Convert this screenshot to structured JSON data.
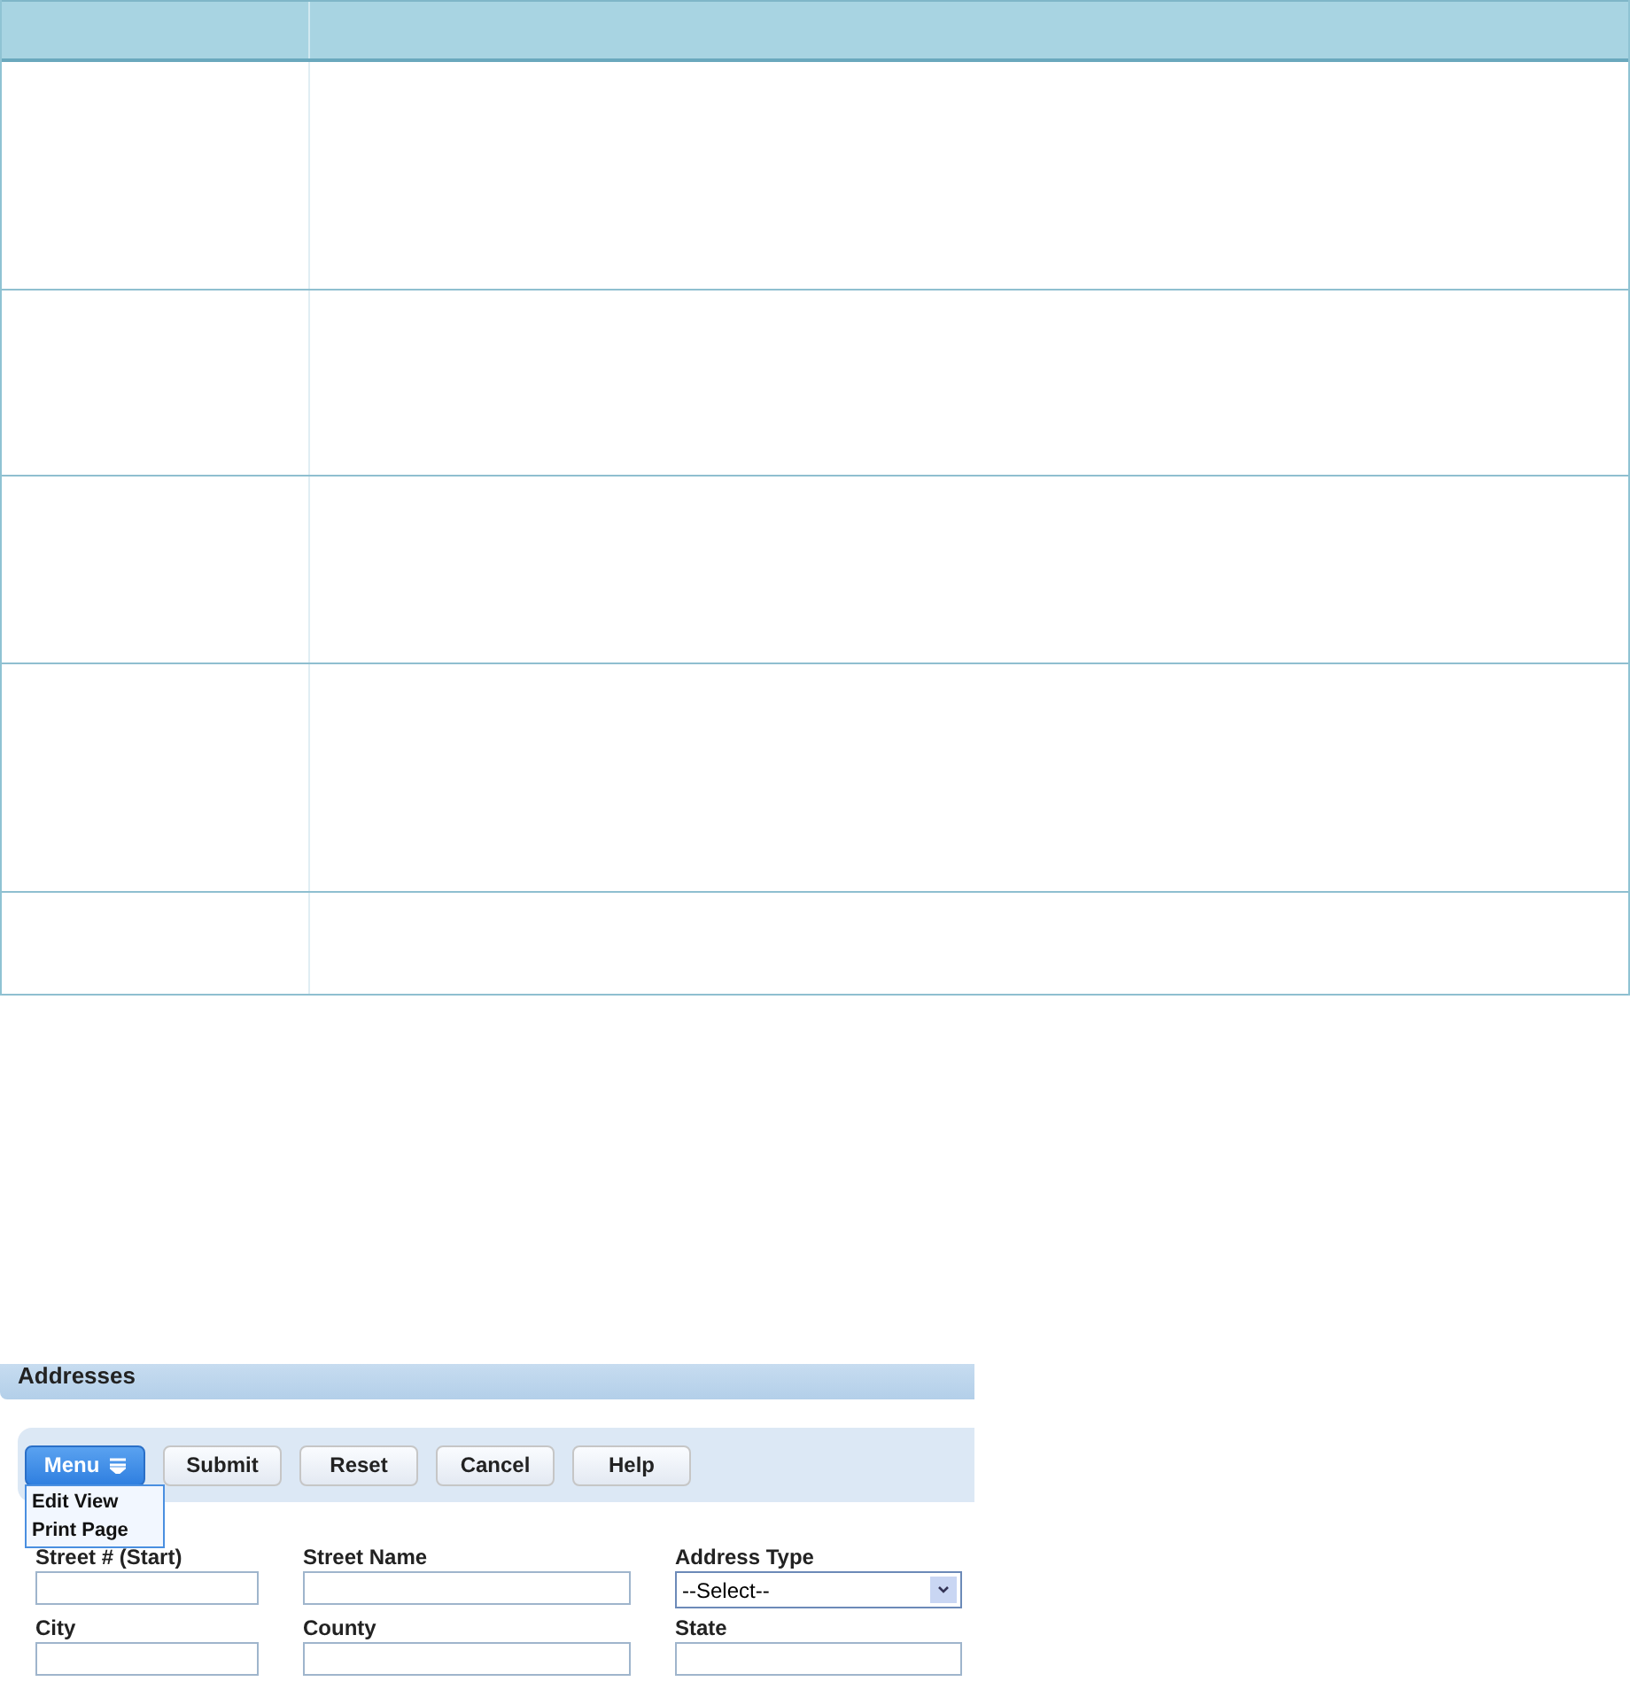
{
  "form": {
    "title": "Addresses",
    "menu": {
      "label": "Menu",
      "expanded": true,
      "items": [
        "Edit View",
        "Print Page"
      ]
    },
    "buttons": [
      "Submit",
      "Reset",
      "Cancel",
      "Help"
    ],
    "fields": [
      {
        "label": "Street # (Start)",
        "kind": "text"
      },
      {
        "label": "Street Name",
        "kind": "text"
      },
      {
        "label": "Address Type",
        "kind": "select",
        "value": "--Select--"
      },
      {
        "label": "City",
        "kind": "text"
      },
      {
        "label": "County",
        "kind": "text"
      },
      {
        "label": "State",
        "kind": "text"
      }
    ]
  }
}
